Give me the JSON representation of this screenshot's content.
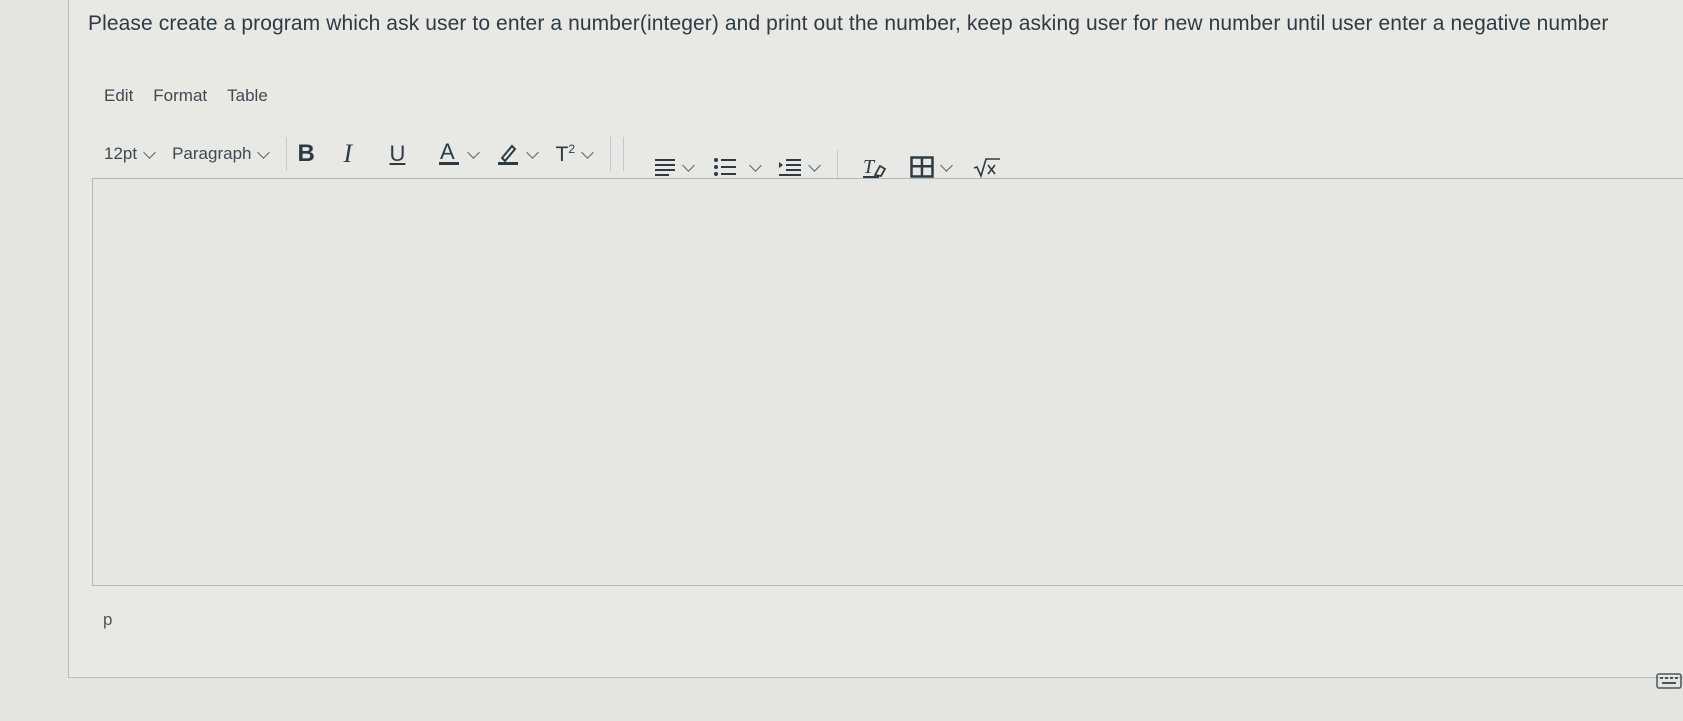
{
  "question": {
    "text": "Please create a program which ask user to enter a number(integer) and print out the number, keep asking user for new number until user enter a negative number"
  },
  "menubar": {
    "edit": "Edit",
    "format": "Format",
    "table": "Table"
  },
  "toolbar": {
    "font_size": "12pt",
    "block_format": "Paragraph",
    "bold": "B",
    "italic": "I",
    "underline": "U",
    "superscript": "T",
    "superscript_exp": "2",
    "icons": [
      "text-color-icon",
      "highlight-icon",
      "superscript-icon",
      "align-icon",
      "bullet-list-icon",
      "indent-icon",
      "clear-formatting-icon",
      "table-icon",
      "math-equation-icon"
    ],
    "accent": "#2d3b45"
  },
  "editor": {
    "content": ""
  },
  "status_bar": {
    "path": "p"
  }
}
